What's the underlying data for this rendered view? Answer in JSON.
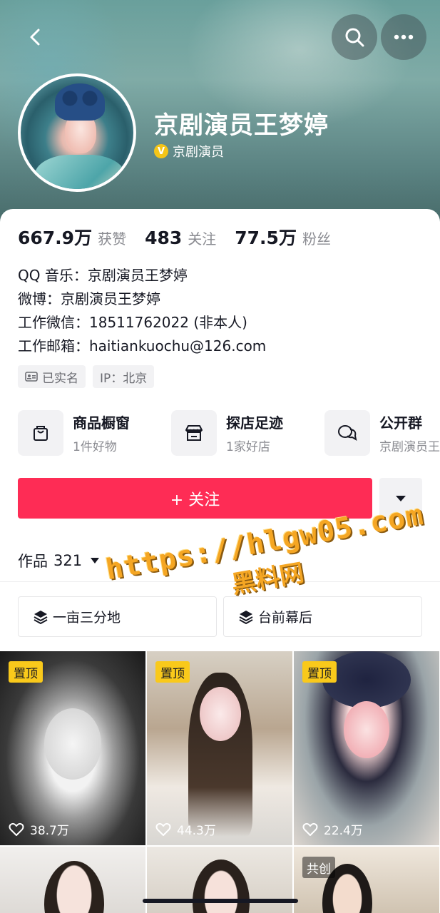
{
  "header": {
    "name": "京剧演员王梦婷",
    "verify_label": "京剧演员",
    "verify_badge": "V"
  },
  "stats": [
    {
      "value": "667.9万",
      "label": "获赞"
    },
    {
      "value": "483",
      "label": "关注"
    },
    {
      "value": "77.5万",
      "label": "粉丝"
    }
  ],
  "bio": {
    "line1": "QQ 音乐：京剧演员王梦婷",
    "line2": "微博：京剧演员王梦婷",
    "line3": "工作微信：18511762022 (非本人)",
    "line4": "工作邮箱：haitiankuochu@126.com"
  },
  "tags": {
    "realname": "已实名",
    "ip": "IP：北京"
  },
  "services": [
    {
      "title": "商品橱窗",
      "sub": "1件好物",
      "icon": "shopping-bag-icon"
    },
    {
      "title": "探店足迹",
      "sub": "1家好店",
      "icon": "store-icon"
    },
    {
      "title": "公开群",
      "sub": "京剧演员王",
      "icon": "chat-group-icon"
    }
  ],
  "follow_label": "+ 关注",
  "works": {
    "label": "作品",
    "count": "321"
  },
  "collections": [
    {
      "label": "一亩三分地",
      "icon": "layers-icon"
    },
    {
      "label": "台前幕后",
      "icon": "layers-icon"
    }
  ],
  "videos": [
    {
      "badge": "置顶",
      "likes": "38.7万"
    },
    {
      "badge": "置顶",
      "likes": "44.3万"
    },
    {
      "badge": "置顶",
      "likes": "22.4万"
    },
    {
      "badge": "",
      "likes": ""
    },
    {
      "badge": "",
      "likes": ""
    },
    {
      "badge": "共创",
      "likes": ""
    }
  ],
  "watermark": {
    "url": "https://hlgw05.com",
    "text": "黑料网"
  },
  "colors": {
    "accent": "#fe2c55",
    "pin_badge": "#f9c91b",
    "verify_badge": "#f5c518"
  }
}
